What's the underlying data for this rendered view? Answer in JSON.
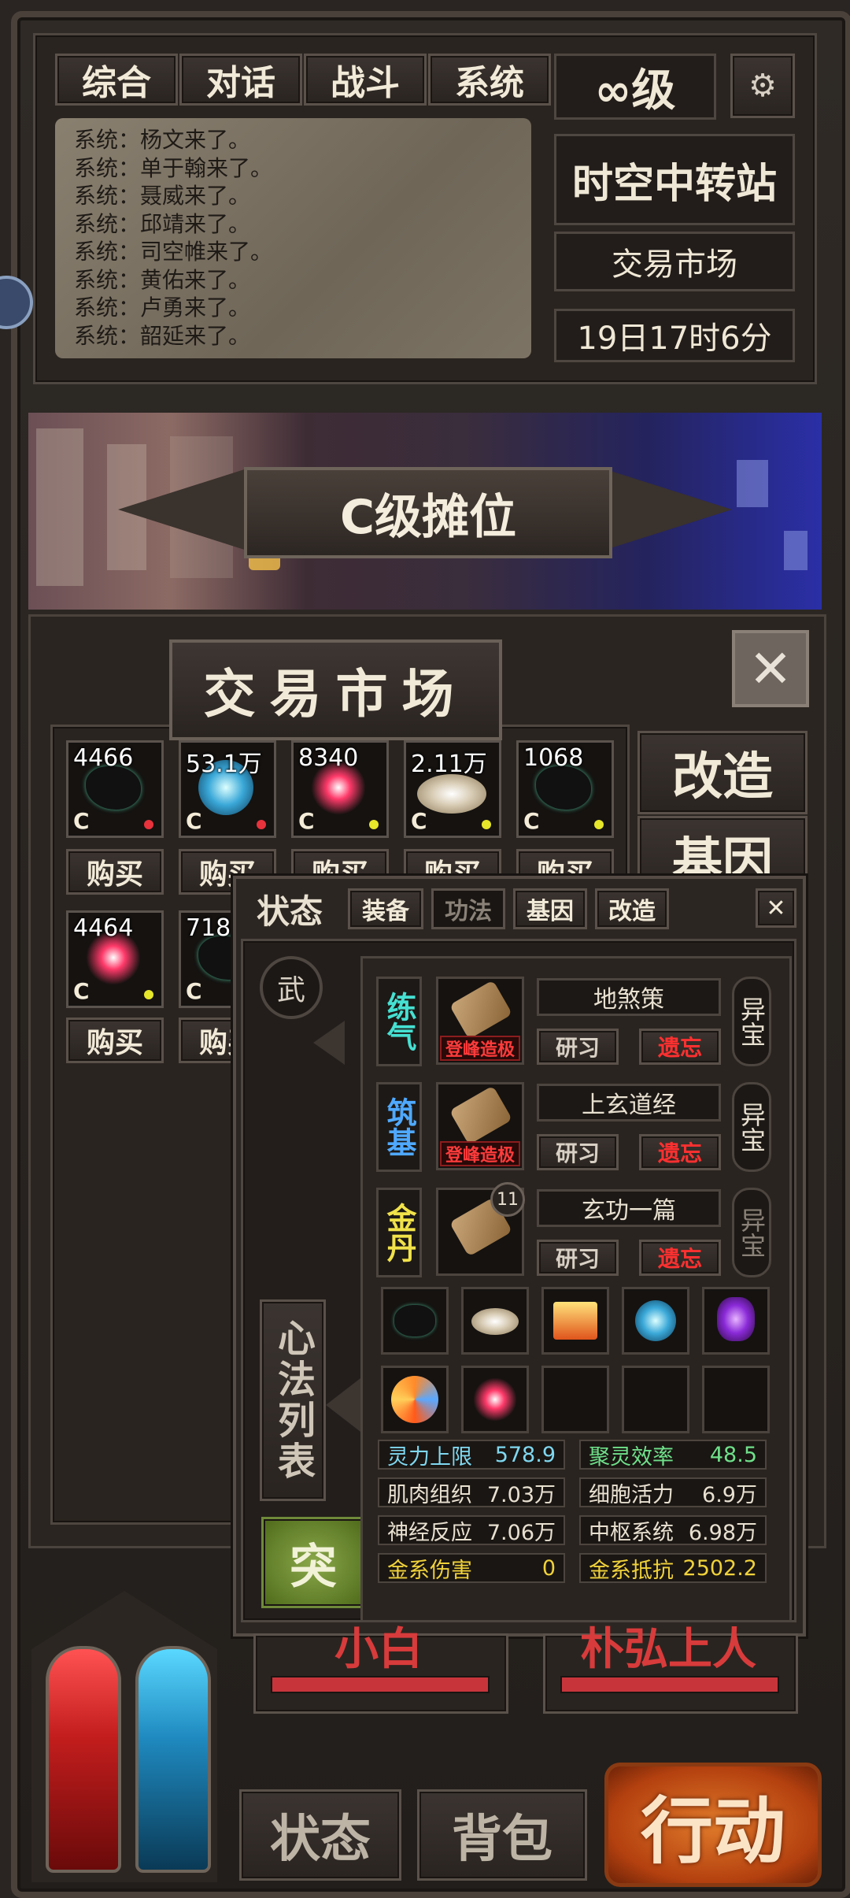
{
  "chat": {
    "tabs": [
      "综合",
      "对话",
      "战斗",
      "系统"
    ],
    "messages": [
      "系统：杨文来了。",
      "系统：单于翰来了。",
      "系统：聂威来了。",
      "系统：邱靖来了。",
      "系统：司空帷来了。",
      "系统：黄佑来了。",
      "系统：卢勇来了。",
      "系统：韶延来了。"
    ]
  },
  "header": {
    "level": "∞级",
    "location": "时空中转站",
    "sub_location": "交易市场",
    "time": "19日17时6分"
  },
  "banner": {
    "title": "C级摊位"
  },
  "market": {
    "title": "交易市场",
    "buy_label": "购买",
    "items": [
      {
        "count": "4466",
        "grade": "C",
        "icon": "dark-ore-icon",
        "dot": "#e8323c"
      },
      {
        "count": "53.1万",
        "grade": "C",
        "icon": "blue-orb-icon",
        "dot": "#e8323c"
      },
      {
        "count": "8340",
        "grade": "C",
        "icon": "red-sparkle-icon",
        "dot": "#e6e62a"
      },
      {
        "count": "2.11万",
        "grade": "C",
        "icon": "pearl-pouch-icon",
        "dot": "#e6e62a"
      },
      {
        "count": "1068",
        "grade": "C",
        "icon": "dark-ore-icon",
        "dot": "#e6e62a"
      },
      {
        "count": "4464",
        "grade": "C",
        "icon": "red-sparkle-icon",
        "dot": "#e6e62a"
      },
      {
        "count": "718",
        "grade": "C",
        "icon": "dark-ore-icon",
        "dot": "#e6e62a"
      }
    ],
    "side_buttons": [
      "改造",
      "基因"
    ]
  },
  "status_panel": {
    "title": "状态",
    "tabs": [
      "装备",
      "功法",
      "基因",
      "改造"
    ],
    "wu_label": "武",
    "list_label": "心法列表",
    "breakthrough_label": "突",
    "learn_label": "研习",
    "forget_label": "遗忘",
    "treasure_label": "异宝",
    "techniques": [
      {
        "realm": "练气",
        "realm_color": "#45e0d2",
        "name": "地煞策",
        "stamp": "登峰造极",
        "badge": ""
      },
      {
        "realm": "筑基",
        "realm_color": "#4fa9ff",
        "name": "上玄道经",
        "stamp": "登峰造极",
        "badge": ""
      },
      {
        "realm": "金丹",
        "realm_color": "#f1e24a",
        "name": "玄功一篇",
        "stamp": "",
        "badge": "11"
      }
    ],
    "item_slots": [
      "dark-ore-icon",
      "pearl-pouch-icon",
      "treasure-chest-icon",
      "blue-orb-icon",
      "purple-crystal-icon",
      "flame-swirl-icon",
      "red-sparkle-icon",
      "empty-slot",
      "empty-slot",
      "empty-slot"
    ],
    "stats": [
      {
        "label": "灵力上限",
        "value": "578.9",
        "color": "#7fd8f0"
      },
      {
        "label": "聚灵效率",
        "value": "48.5",
        "color": "#6fe08a"
      },
      {
        "label": "肌肉组织",
        "value": "7.03万",
        "color": "#e8e0d0"
      },
      {
        "label": "细胞活力",
        "value": "6.9万",
        "color": "#e8e0d0"
      },
      {
        "label": "神经反应",
        "value": "7.06万",
        "color": "#e8e0d0"
      },
      {
        "label": "中枢系统",
        "value": "6.98万",
        "color": "#e8e0d0"
      },
      {
        "label": "金系伤害",
        "value": "0",
        "color": "#f0d23a"
      },
      {
        "label": "金系抵抗",
        "value": "2502.2",
        "color": "#f0d23a"
      }
    ]
  },
  "bottom": {
    "ally_left": "小白",
    "ally_right": "朴弘上人",
    "status_button": "状态",
    "bag_button": "背包",
    "action_button": "行动"
  }
}
